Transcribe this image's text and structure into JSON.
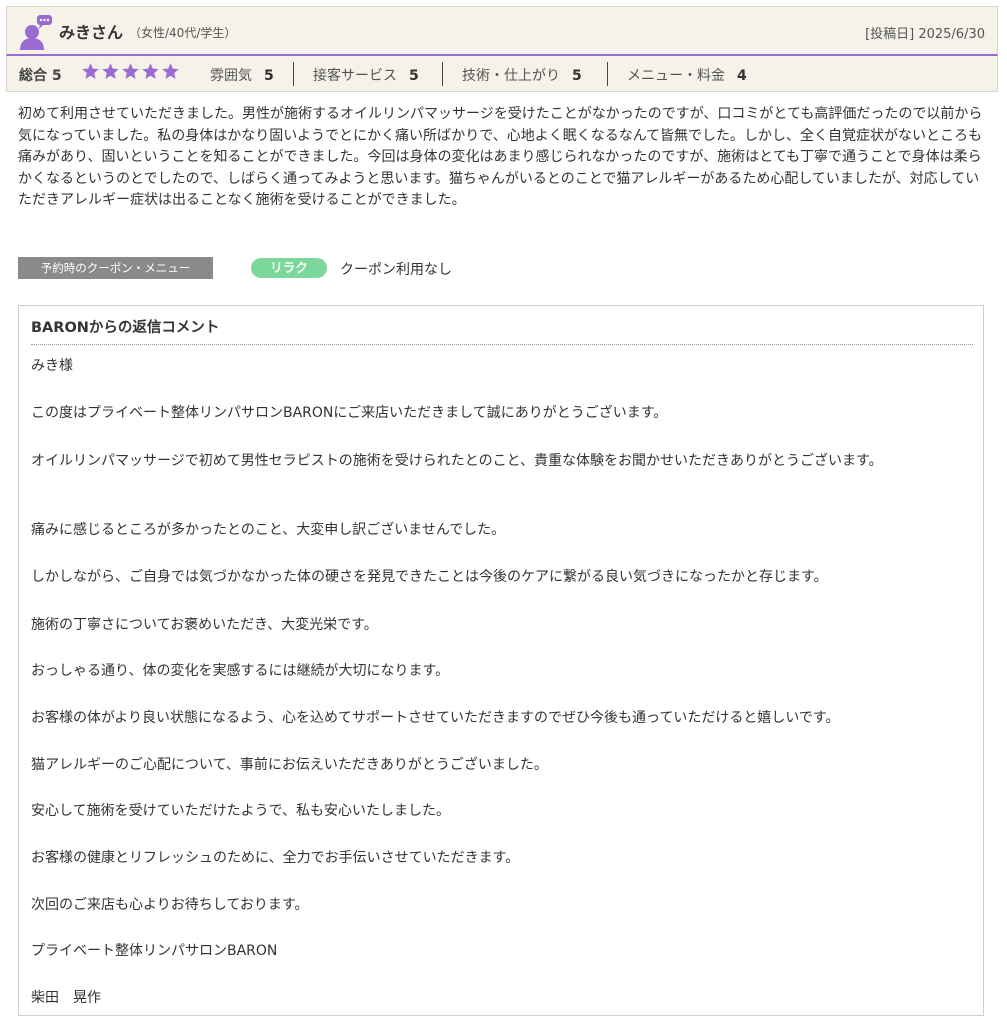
{
  "review": {
    "reviewer_name": "みきさん",
    "reviewer_meta": "（女性/40代/学生）",
    "post_date": "[投稿日] 2025/6/30",
    "accent_color": "#9a6bd0",
    "avatar_icon": "user-chat-icon"
  },
  "ratings": {
    "total_label": "総合",
    "total_value": "5",
    "stars_filled": 5,
    "star_color": "#9a6bd0",
    "categories": [
      {
        "label": "雰囲気",
        "value": "5"
      },
      {
        "label": "接客サービス",
        "value": "5"
      },
      {
        "label": "技術・仕上がり",
        "value": "5"
      },
      {
        "label": "メニュー・料金",
        "value": "4"
      }
    ]
  },
  "body": "初めて利用させていただきました。男性が施術するオイルリンパマッサージを受けたことがなかったのですが、口コミがとても高評価だったので以前から気になっていました。私の身体はかなり固いようでとにかく痛い所ばかりで、心地よく眠くなるなんて皆無でした。しかし、全く自覚症状がないところも痛みがあり、固いということを知ることができました。今回は身体の変化はあまり感じられなかったのですが、施術はとても丁寧で通うことで身体は柔らかくなるというのとでしたので、しばらく通ってみようと思います。猫ちゃんがいるとのことで猫アレルギーがあるため心配していましたが、対応していただきアレルギー症状は出ることなく施術を受けることができました。",
  "coupon": {
    "label": "予約時のクーポン・メニュー",
    "tag": "リラク",
    "tag_color": "#7bd89a",
    "value": "クーポン利用なし"
  },
  "reply": {
    "title": "BARONからの返信コメント",
    "paragraphs": [
      "みき様",
      "この度はプライベート整体リンパサロンBARONにご来店いただきまして誠にありがとうございます。",
      "オイルリンパマッサージで初めて男性セラピストの施術を受けられたとのこと、貴重な体験をお聞かせいただきありがとうございます。",
      "痛みに感じるところが多かったとのこと、大変申し訳ございませんでした。",
      "しかしながら、ご自身では気づかなかった体の硬さを発見できたことは今後のケアに繋がる良い気づきになったかと存じます。",
      "施術の丁寧さについてお褒めいただき、大変光栄です。",
      "おっしゃる通り、体の変化を実感するには継続が大切になります。",
      "お客様の体がより良い状態になるよう、心を込めてサポートさせていただきますのでぜひ今後も通っていただけると嬉しいです。",
      "猫アレルギーのご心配について、事前にお伝えいただきありがとうございました。",
      "安心して施術を受けていただけたようで、私も安心いたしました。",
      "お客様の健康とリフレッシュのために、全力でお手伝いさせていただきます。",
      "次回のご来店も心よりお待ちしております。",
      "プライベート整体リンパサロンBARON",
      "柴田　晃作"
    ]
  }
}
